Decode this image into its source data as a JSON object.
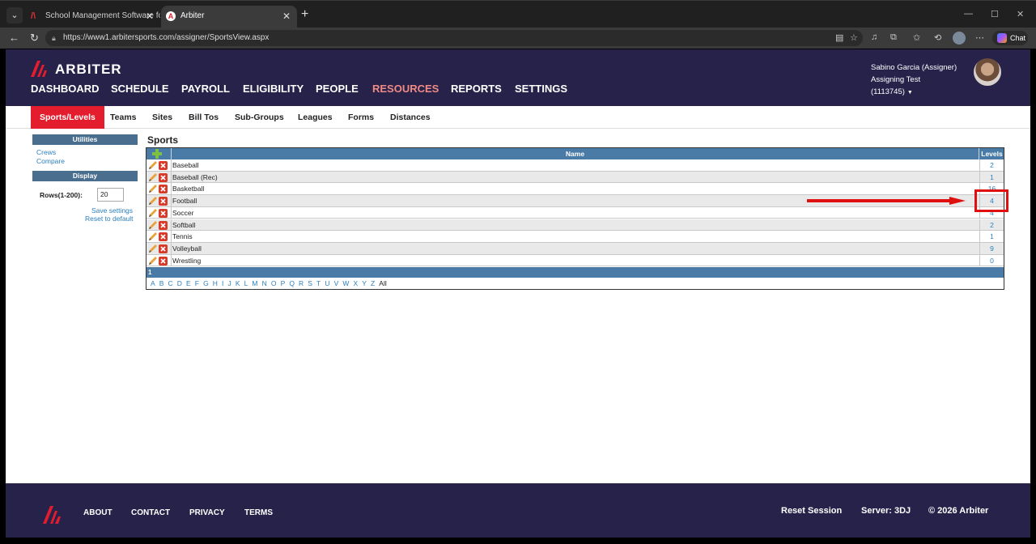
{
  "browser": {
    "tabs": [
      {
        "title": "School Management Software for"
      },
      {
        "title": "Arbiter"
      }
    ],
    "url": "https://www1.arbitersports.com/assigner/SportsView.aspx",
    "chat_label": "Chat"
  },
  "header": {
    "brand": "ARBITER",
    "nav": [
      "DASHBOARD",
      "SCHEDULE",
      "PAYROLL",
      "ELIGIBILITY",
      "PEOPLE",
      "RESOURCES",
      "REPORTS",
      "SETTINGS"
    ],
    "active_nav": "RESOURCES",
    "user_name": "Sabino Garcia (Assigner)",
    "account": "Assigning Test (1113745)"
  },
  "subnav": {
    "items": [
      "Sports/Levels",
      "Teams",
      "Sites",
      "Bill Tos",
      "Sub-Groups",
      "Leagues",
      "Forms",
      "Distances"
    ],
    "active": "Sports/Levels"
  },
  "sidebar": {
    "utilities_title": "Utilities",
    "utilities": [
      "Crews",
      "Compare"
    ],
    "display_title": "Display",
    "rows_label": "Rows(1-200):",
    "rows_value": "20",
    "save_settings": "Save settings",
    "reset_default": "Reset to default"
  },
  "sports": {
    "title": "Sports",
    "col_name": "Name",
    "col_levels": "Levels",
    "rows": [
      {
        "name": "Baseball",
        "levels": "2"
      },
      {
        "name": "Baseball (Rec)",
        "levels": "1"
      },
      {
        "name": "Basketball",
        "levels": "16"
      },
      {
        "name": "Football",
        "levels": "4"
      },
      {
        "name": "Soccer",
        "levels": "4"
      },
      {
        "name": "Softball",
        "levels": "2"
      },
      {
        "name": "Tennis",
        "levels": "1"
      },
      {
        "name": "Volleyball",
        "levels": "9"
      },
      {
        "name": "Wrestling",
        "levels": "0"
      }
    ],
    "page": "1",
    "alphabet": [
      "A",
      "B",
      "C",
      "D",
      "E",
      "F",
      "G",
      "H",
      "I",
      "J",
      "K",
      "L",
      "M",
      "N",
      "O",
      "P",
      "Q",
      "R",
      "S",
      "T",
      "U",
      "V",
      "W",
      "X",
      "Y",
      "Z"
    ],
    "all_label": "All"
  },
  "annotation": {
    "color": "#e01010"
  },
  "footer": {
    "links": [
      "ABOUT",
      "CONTACT",
      "PRIVACY",
      "TERMS"
    ],
    "reset_session": "Reset Session",
    "server": "Server: 3DJ",
    "copyright": "© 2026 Arbiter"
  },
  "colors": {
    "header_bg": "#27224a",
    "accent_red": "#e31d2d",
    "table_header": "#4a7ba6",
    "link": "#2a7fbf"
  }
}
